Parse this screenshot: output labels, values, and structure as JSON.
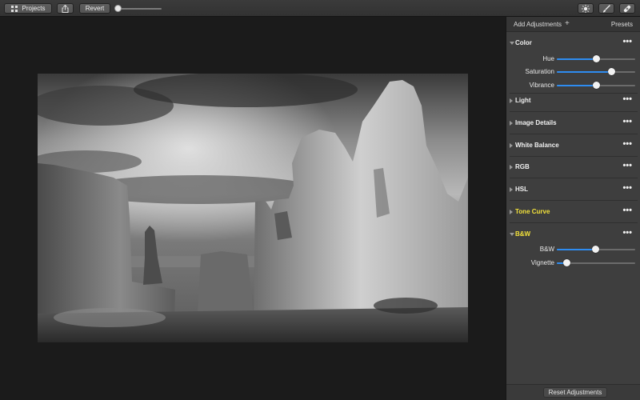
{
  "toolbar": {
    "projects_label": "Projects",
    "revert_label": "Revert",
    "zoom_level": 0.0
  },
  "panel": {
    "add_adjustments_label": "Add Adjustments",
    "presets_label": "Presets",
    "more_glyph": "•••",
    "reset_label": "Reset Adjustments",
    "accent_color": "#2e8cf0",
    "highlight_color": "#f3e23b"
  },
  "sections": {
    "color": {
      "title": "Color",
      "expanded": true,
      "sliders": [
        {
          "label": "Hue",
          "value": 0.5
        },
        {
          "label": "Saturation",
          "value": 0.69
        },
        {
          "label": "Vibrance",
          "value": 0.5
        }
      ]
    },
    "light": {
      "title": "Light"
    },
    "image_details": {
      "title": "Image Details"
    },
    "white_balance": {
      "title": "White Balance"
    },
    "rgb": {
      "title": "RGB"
    },
    "hsl": {
      "title": "HSL"
    },
    "tone_curve": {
      "title": "Tone Curve"
    },
    "bw": {
      "title": "B&W",
      "expanded": true,
      "sliders": [
        {
          "label": "B&W",
          "value": 0.49
        },
        {
          "label": "Vignette",
          "value": 0.12
        }
      ]
    }
  }
}
